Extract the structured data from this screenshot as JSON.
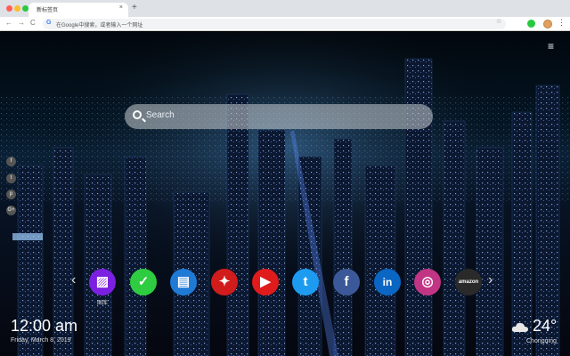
{
  "browser": {
    "tab_title": "新标签页",
    "tab_close": "×",
    "new_tab": "+",
    "back": "←",
    "forward": "→",
    "reload": "C",
    "address_placeholder": "在Google中搜索，或者输入一个网址",
    "google_g": "G",
    "star": "☆",
    "menu": "⋮"
  },
  "search": {
    "placeholder": "Search"
  },
  "menu_icon": "≡",
  "social_icons": [
    "facebook-icon",
    "twitter-icon",
    "pinterest-icon",
    "google-plus-icon"
  ],
  "social_glyphs": [
    "f",
    "t",
    "p",
    "G+"
  ],
  "apps": [
    {
      "name": "gallery",
      "glyph": "▨",
      "label": "图库",
      "color": "#7b1fe0"
    },
    {
      "name": "checklist",
      "glyph": "✓",
      "label": "",
      "color": "#2ecc40"
    },
    {
      "name": "news",
      "glyph": "▤",
      "label": "",
      "color": "#1f7ad6"
    },
    {
      "name": "game",
      "glyph": "✦",
      "label": "",
      "color": "#d11c1c"
    },
    {
      "name": "youtube",
      "glyph": "▶",
      "label": "",
      "color": "#e01b1b"
    },
    {
      "name": "twitter",
      "glyph": "t",
      "label": "",
      "color": "#1d9bf0"
    },
    {
      "name": "facebook",
      "glyph": "f",
      "label": "",
      "color": "#3b5998"
    },
    {
      "name": "linkedin",
      "glyph": "in",
      "label": "",
      "color": "#0a66c2"
    },
    {
      "name": "instagram",
      "glyph": "◎",
      "label": "",
      "color": "#c13584"
    },
    {
      "name": "amazon",
      "glyph": "amazon",
      "label": "",
      "color": "#2a2a2a"
    }
  ],
  "nav": {
    "prev": "‹",
    "next": "›"
  },
  "clock": {
    "time": "12:00 am",
    "date": "Friday, March 8, 2019"
  },
  "weather": {
    "temp": "24°",
    "city": "Chongqing"
  }
}
